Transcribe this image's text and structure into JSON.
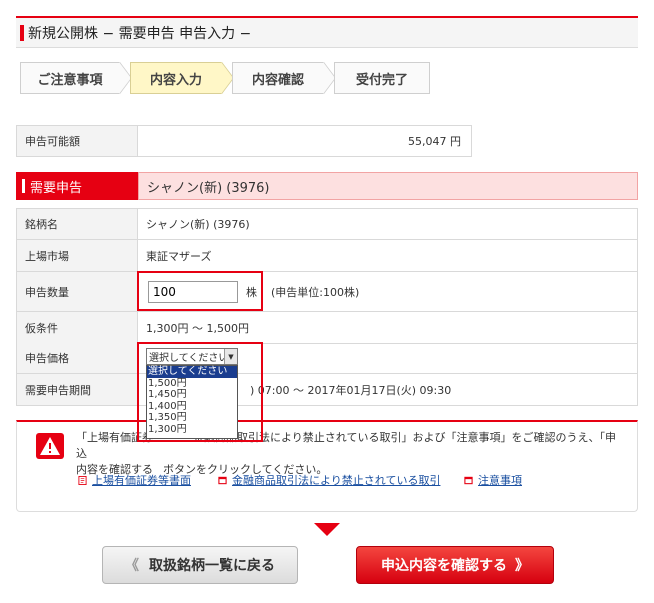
{
  "title": "新規公開株 − 需要申告 申告入力 −",
  "steps": [
    "ご注意事項",
    "内容入力",
    "内容確認",
    "受付完了"
  ],
  "available": {
    "label": "申告可能額",
    "value": "55,047 円"
  },
  "section": {
    "label": "需要申告",
    "stock": "シャノン(新) (3976)"
  },
  "rows": {
    "name": {
      "label": "銘柄名",
      "value": "シャノン(新) (3976)"
    },
    "market": {
      "label": "上場市場",
      "value": "東証マザーズ"
    },
    "qty": {
      "label": "申告数量",
      "value": "100",
      "unit": "株",
      "note": "(申告単位:100株)"
    },
    "cond": {
      "label": "仮条件",
      "value": "1,300円 〜 1,500円"
    },
    "price": {
      "label": "申告価格",
      "selected": "選択してください"
    },
    "period": {
      "label": "需要申告期間",
      "value": ") 07:00 〜 2017年01月17日(火) 09:30"
    }
  },
  "price_options": [
    "選択してください",
    "1,500円",
    "1,450円",
    "1,400円",
    "1,350円",
    "1,300円"
  ],
  "notice": {
    "line1": "「上場有価証券",
    "line1_rest": "金融商品取引法により禁止されている取引」および「注意事項」をご確認のうえ、「申込",
    "line2": "内容を確認する",
    "line2_rest": "ボタンをクリックしてください。"
  },
  "links": [
    "上場有価証券等書面",
    "金融商品取引法により禁止されている取引",
    "注意事項"
  ],
  "buttons": {
    "back": "取扱銘柄一覧に戻る",
    "confirm": "申込内容を確認する"
  },
  "colors": {
    "accent": "#e60012",
    "link": "#1a4fa0",
    "select_highlight": "#1a3d8f"
  }
}
